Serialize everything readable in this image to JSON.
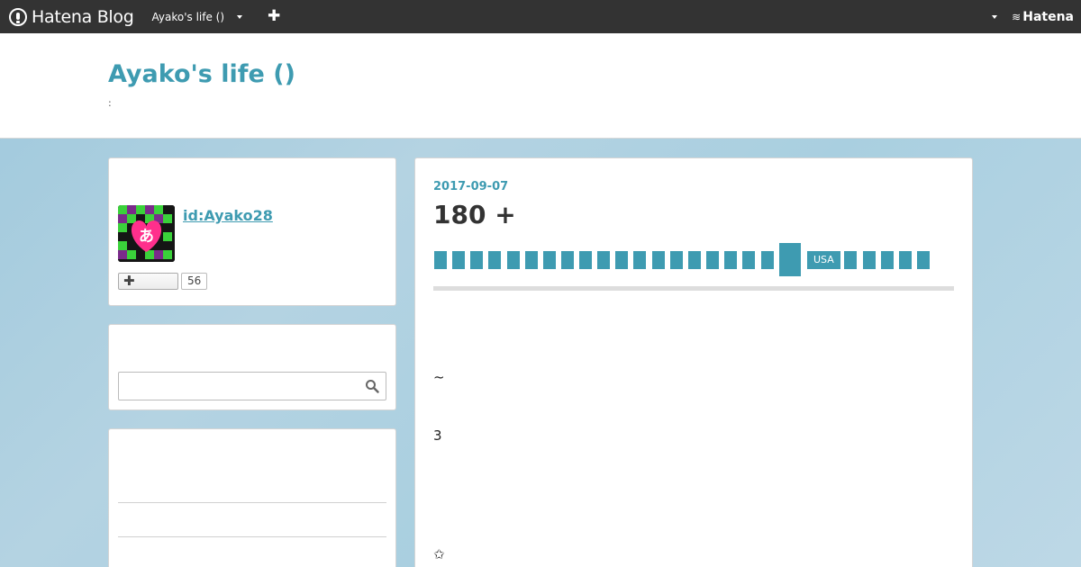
{
  "topbar": {
    "brand": "Hatena Blog",
    "blog_switch": "Ayako's life ()",
    "add_label": "✚",
    "account_mark": "Hatena"
  },
  "header": {
    "title": "Ayako's life ()",
    "description": ":"
  },
  "profile": {
    "id": "id:Ayako28",
    "avatar_glyph": "あ",
    "subscribe_label": "✚",
    "subscribe_count": "56"
  },
  "search": {
    "placeholder": ""
  },
  "article": {
    "date": "2017-09-07",
    "title": "180 +",
    "tag_text": "USA",
    "lines": [
      "~",
      "3",
      "✩"
    ]
  },
  "colors": {
    "accent": "#3e9bb1",
    "topbar": "#333333"
  }
}
